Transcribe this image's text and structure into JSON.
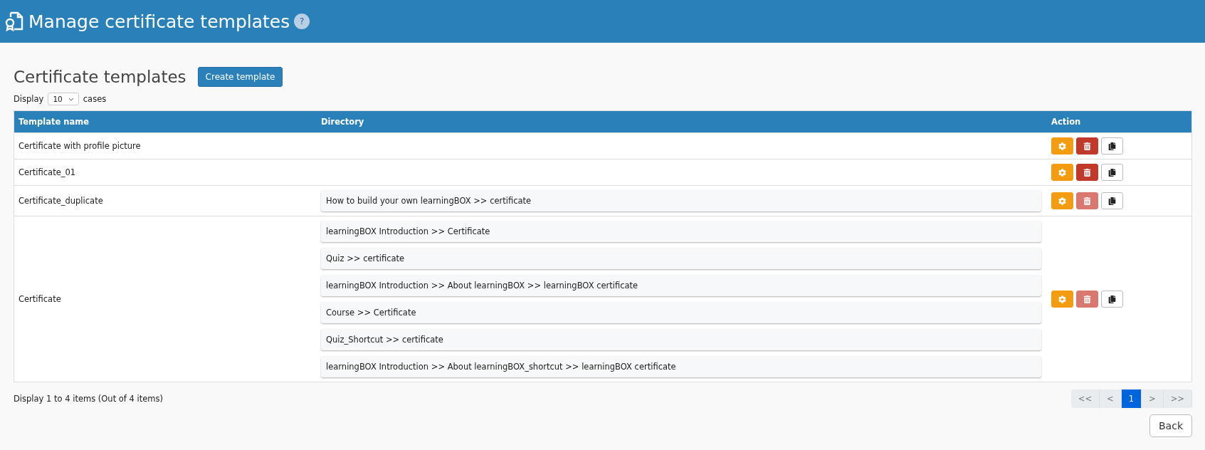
{
  "header": {
    "title": "Manage certificate templates",
    "help": "?"
  },
  "section": {
    "title": "Certificate templates",
    "create_button": "Create template"
  },
  "page_size": {
    "label_before": "Display",
    "value": "10",
    "label_after": "cases"
  },
  "table": {
    "columns": [
      "Template name",
      "Directory",
      "Action"
    ],
    "rows": [
      {
        "name": "Certificate with profile picture",
        "directories": [],
        "delete_disabled": false
      },
      {
        "name": "Certificate_01",
        "directories": [],
        "delete_disabled": false
      },
      {
        "name": "Certificate_duplicate",
        "directories": [
          "How to build your own learningBOX >> certificate"
        ],
        "delete_disabled": true
      },
      {
        "name": "Certificate",
        "directories": [
          "learningBOX Introduction >> Certificate",
          "Quiz >> certificate",
          "learningBOX Introduction >> About learningBOX >> learningBOX certificate",
          "Course >> Certificate",
          "Quiz_Shortcut >> certificate",
          "learningBOX Introduction >> About learningBOX_shortcut >> learningBOX certificate"
        ],
        "delete_disabled": true
      }
    ]
  },
  "summary": "Display 1 to 4 items (Out of 4 items)",
  "pagination": [
    {
      "label": "<<",
      "selected": false
    },
    {
      "label": "<",
      "selected": false
    },
    {
      "label": "1",
      "selected": true
    },
    {
      "label": ">",
      "selected": false
    },
    {
      "label": ">>",
      "selected": false
    }
  ],
  "back_button": "Back"
}
